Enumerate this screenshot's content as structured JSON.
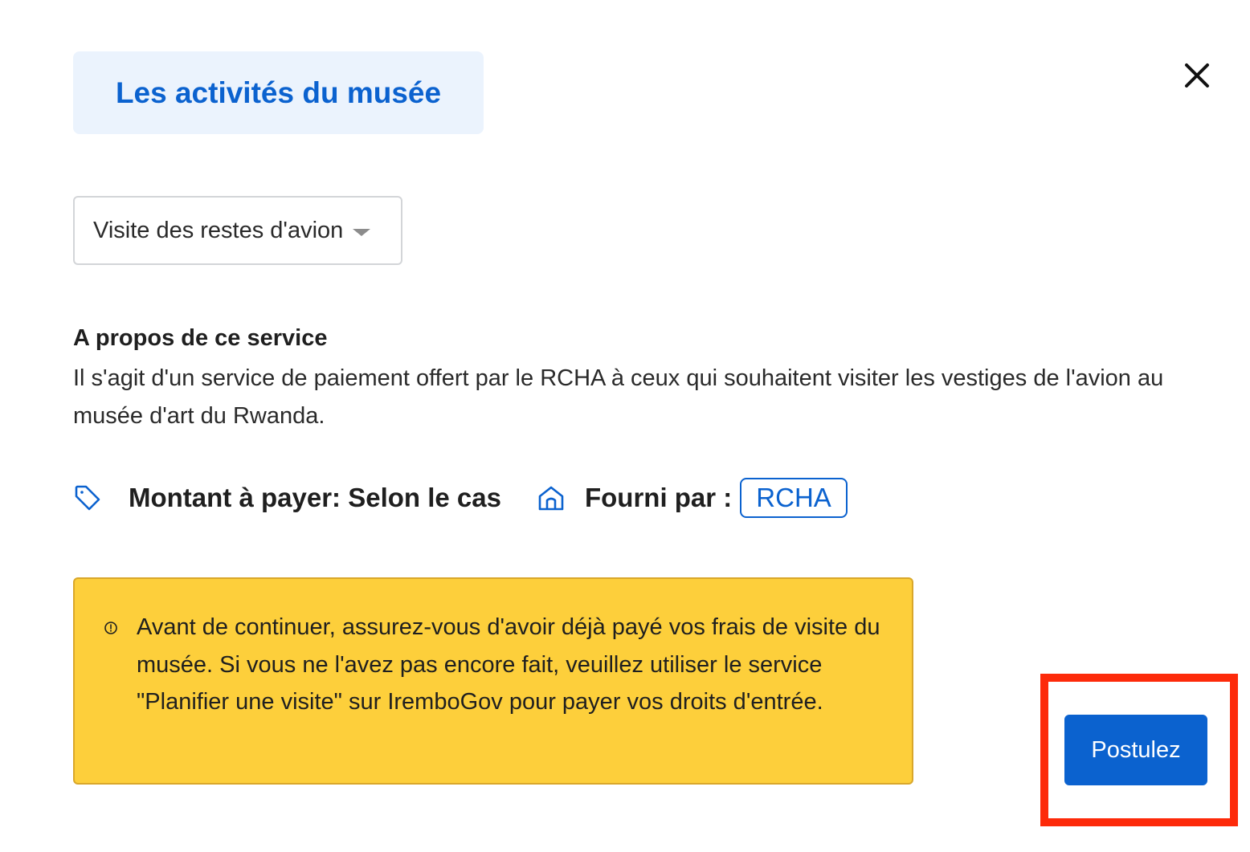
{
  "header": {
    "title": "Les activités du musée"
  },
  "activity_select": {
    "selected_value": "Visite des restes d'avion"
  },
  "about": {
    "heading": "A propos de ce service",
    "description": "Il s'agit d'un service de paiement offert par le RCHA à ceux qui souhaitent visiter les vestiges de l'avion au musée d'art du Rwanda."
  },
  "meta": {
    "price_label": "Montant à payer: Selon le cas",
    "provider_label": "Fourni par :",
    "provider_name": "RCHA"
  },
  "alert": {
    "message": "Avant de continuer, assurez-vous d'avoir déjà payé vos frais de visite du musée. Si vous ne l'avez pas encore fait, veuillez utiliser le service \"Planifier une visite\" sur IremboGov pour payer vos droits d'entrée."
  },
  "actions": {
    "apply_label": "Postulez"
  },
  "icons": {
    "close": "close-icon",
    "price": "tag-icon",
    "provider": "building-icon",
    "alert": "info-circle-icon",
    "dropdown": "caret-down-icon"
  },
  "colors": {
    "primary": "#0b62cf",
    "title_chip_bg": "#ebf3fd",
    "alert_bg": "#fdcf3b",
    "highlight": "#fd2a0a"
  }
}
